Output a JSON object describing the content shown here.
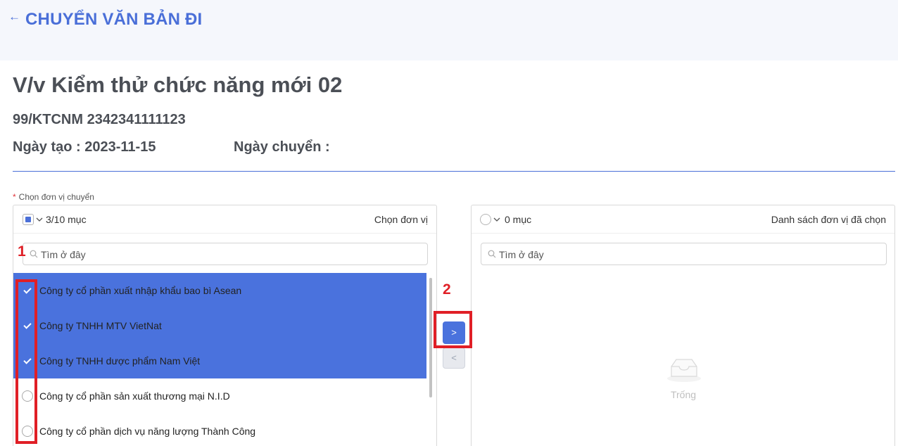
{
  "header": {
    "title": "CHUYỂN VĂN BẢN ĐI",
    "back_icon": "arrow-left-icon"
  },
  "document": {
    "title": "V/v Kiểm thử chức năng mới 02",
    "number": "99/KTCNM 2342341111123",
    "created_label": "Ngày tạo : 2023-11-15",
    "transfer_label": "Ngày chuyển :"
  },
  "form": {
    "required_mark": "*",
    "label": "Chọn đơn vị chuyển"
  },
  "source_panel": {
    "count": "3/10 mục",
    "title": "Chọn đơn vị",
    "search_placeholder": "Tìm ở đây",
    "items": [
      {
        "label": "Công ty cổ phần xuất nhập khẩu bao bì Asean",
        "selected": true
      },
      {
        "label": "Công ty TNHH MTV VietNat",
        "selected": true
      },
      {
        "label": "Công ty TNHH dược phẩm Nam Việt",
        "selected": true
      },
      {
        "label": "Công ty cổ phần sản xuất thương mại N.I.D",
        "selected": false
      },
      {
        "label": "Công ty cổ phần dịch vụ năng lượng Thành Công",
        "selected": false
      }
    ]
  },
  "target_panel": {
    "count": "0 mục",
    "title": "Danh sách đơn vị đã chọn",
    "search_placeholder": "Tìm ở đây",
    "empty_text": "Trống"
  },
  "transfer": {
    "right_glyph": ">",
    "left_glyph": "<"
  },
  "annotations": {
    "box1": "1",
    "box2": "2"
  },
  "colors": {
    "accent": "#4a72dd",
    "annotation": "#e01f26",
    "title_blue": "#4a6fd8"
  }
}
